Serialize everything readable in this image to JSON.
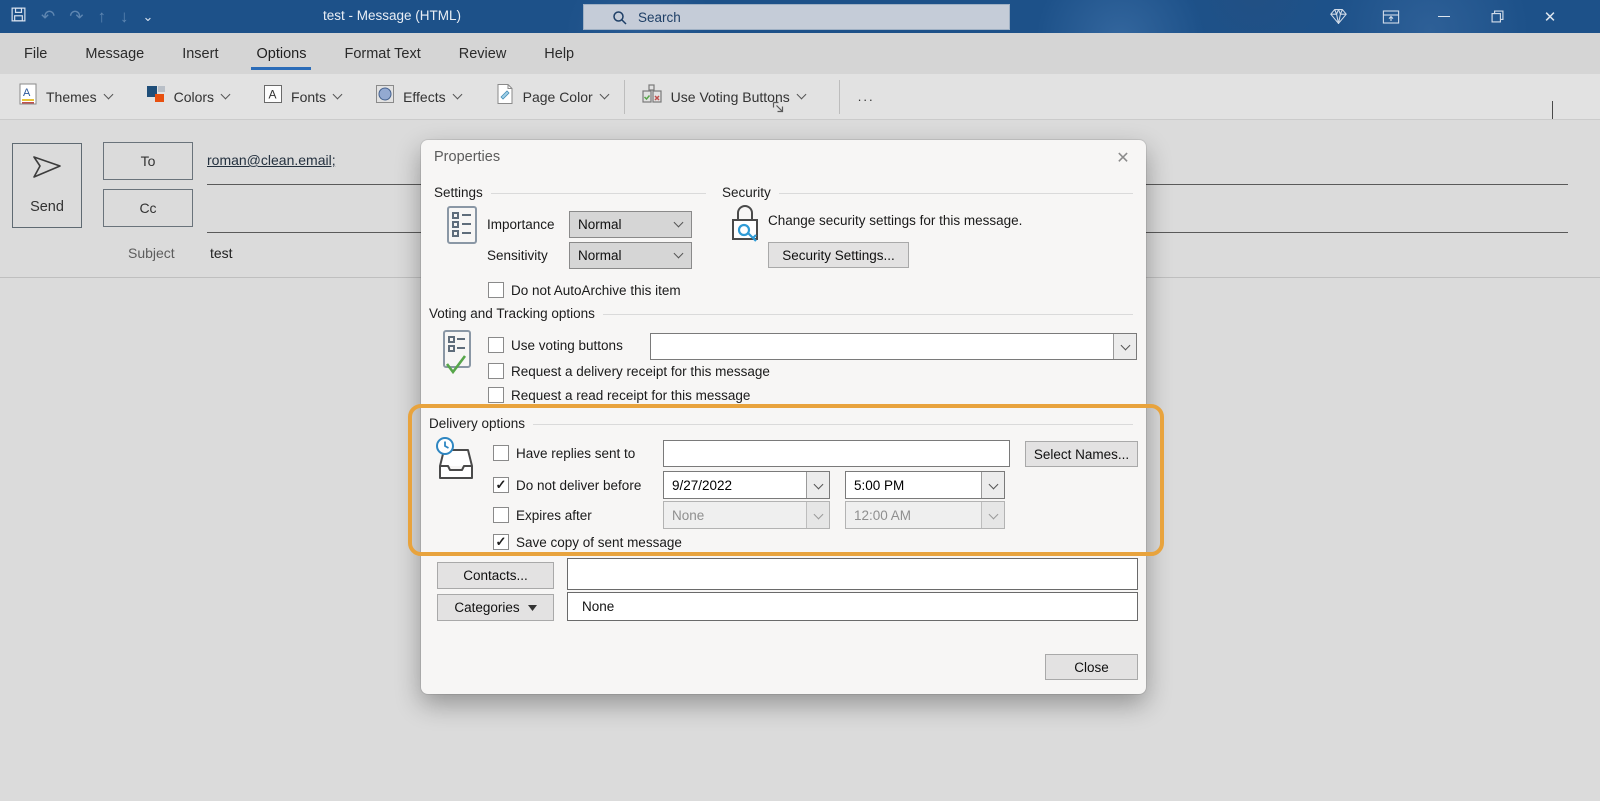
{
  "colors": {
    "titlebar": "#1d5189",
    "accent": "#2b6cb8",
    "ring": "#e8a33d"
  },
  "titlebar": {
    "title": "test - Message (HTML)",
    "search_placeholder": "Search"
  },
  "icons": {
    "arrow_up": "↑",
    "arrow_down": "↓",
    "undo": "↶",
    "redo": "↷",
    "close": "✕",
    "qat_chevron": "⌄"
  },
  "ribbon": {
    "tabs": [
      {
        "label": "File"
      },
      {
        "label": "Message"
      },
      {
        "label": "Insert"
      },
      {
        "label": "Options"
      },
      {
        "label": "Format Text"
      },
      {
        "label": "Review"
      },
      {
        "label": "Help"
      }
    ],
    "active_tab": "Options",
    "buttons": {
      "themes": "Themes",
      "colors": "Colors",
      "fonts": "Fonts",
      "effects": "Effects",
      "page_color": "Page Color",
      "voting": "Use Voting Buttons",
      "more": "..."
    }
  },
  "compose": {
    "send": "Send",
    "to_label": "To",
    "to_value": "roman@clean.email;",
    "cc_label": "Cc",
    "subject_label": "Subject",
    "subject_value": "test"
  },
  "dialog": {
    "title": "Properties",
    "settings": {
      "header": "Settings",
      "importance_label": "Importance",
      "importance_value": "Normal",
      "sensitivity_label": "Sensitivity",
      "sensitivity_value": "Normal",
      "autoarchive_label": "Do not AutoArchive this item",
      "autoarchive_checked": ""
    },
    "security": {
      "header": "Security",
      "description": "Change security settings for this message.",
      "button_label": "Security Settings..."
    },
    "voting": {
      "header": "Voting and Tracking options",
      "use_voting_label": "Use voting buttons",
      "use_voting_checked": "",
      "use_voting_value": "",
      "delivery_receipt_label": "Request a delivery receipt for this message",
      "delivery_receipt_checked": "",
      "read_receipt_label": "Request a read receipt for this message",
      "read_receipt_checked": ""
    },
    "delivery": {
      "header": "Delivery options",
      "have_replies_label": "Have replies sent to",
      "have_replies_checked": "",
      "have_replies_value": "",
      "select_names_label": "Select Names...",
      "deliver_before_label": "Do not deliver before",
      "deliver_before_checked": "✓",
      "deliver_before_date": "9/27/2022",
      "deliver_before_time": "5:00 PM",
      "expires_label": "Expires after",
      "expires_checked": "",
      "expires_date": "None",
      "expires_time": "12:00 AM",
      "save_copy_label": "Save copy of sent message",
      "save_copy_checked": "✓"
    },
    "footer": {
      "contacts_label": "Contacts...",
      "contacts_value": "",
      "categories_prefix": "Cate",
      "categories_accel": "g",
      "categories_suffix": "ories",
      "categories_value": "None",
      "close_label": "Close"
    }
  }
}
